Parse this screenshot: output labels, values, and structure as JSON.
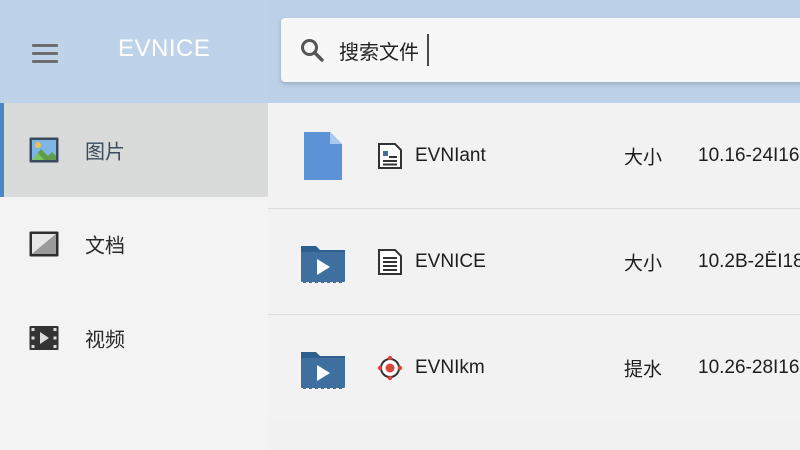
{
  "app": {
    "title": "EVNICE"
  },
  "colors": {
    "accent": "#4a86c8",
    "header_bg": "#bed2ea",
    "folder_blue": "#3f6f9e",
    "doc_blue": "#5b93d6"
  },
  "search": {
    "value": "搜索文件",
    "icon": "search-icon"
  },
  "sidebar": {
    "items": [
      {
        "label": "图片",
        "icon": "image-icon",
        "active": true
      },
      {
        "label": "文档",
        "icon": "document-icon",
        "active": false
      },
      {
        "label": "视频",
        "icon": "video-icon",
        "active": false
      }
    ]
  },
  "files": [
    {
      "name": "EVNIant",
      "size": "大小",
      "date": "10.16-24I16",
      "big_icon": "document-file-icon",
      "small_icon": "doc-type-icon"
    },
    {
      "name": "EVNICE",
      "size": "大小",
      "date": "10.2B-2ЁI18",
      "big_icon": "video-folder-icon",
      "small_icon": "doc-type-icon"
    },
    {
      "name": "EVNIkm",
      "size": "提水",
      "date": "10.26-28I16",
      "big_icon": "video-folder-icon",
      "small_icon": "target-type-icon"
    }
  ]
}
